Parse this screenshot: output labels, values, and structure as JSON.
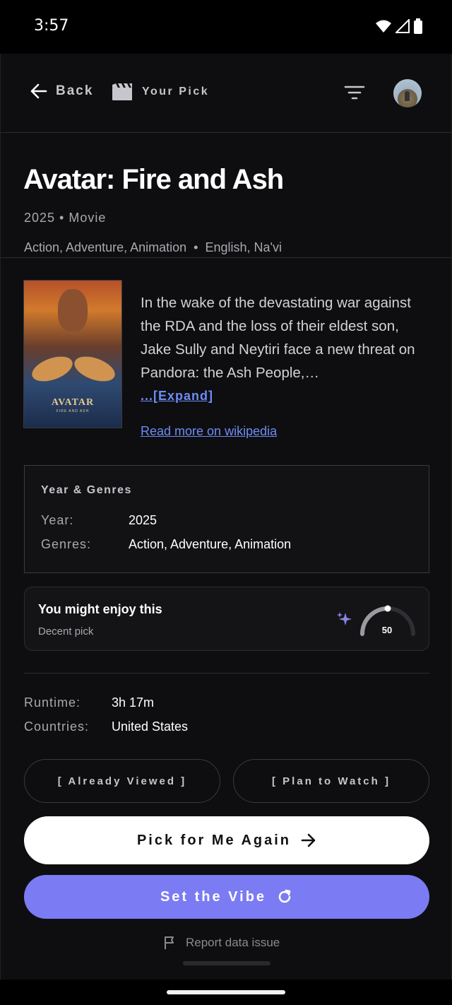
{
  "status_bar": {
    "time": "3:57",
    "icons": [
      "wifi-icon",
      "signal-icon",
      "battery-icon"
    ]
  },
  "nav": {
    "back_label": "Back",
    "brand_label": "Your Pick",
    "icons": [
      "arrow-left-icon",
      "clapperboard-icon",
      "filter-icon"
    ]
  },
  "movie": {
    "title": "Avatar: Fire and Ash",
    "meta": "2025 • Movie",
    "genres_line": "Action, Adventure, Animation",
    "languages": "English, Na'vi",
    "poster_title": "AVATAR",
    "poster_subtitle": "FIRE AND ASH",
    "synopsis": "In the wake of the devastating war against the RDA and the loss of their eldest son, Jake Sully and Neytiri face a new threat on Pandora: the Ash People,…",
    "expand_label": "...[Expand]",
    "wiki_label": "Read more on wikipedia"
  },
  "year_genres": {
    "heading": "Year & Genres",
    "year_key": "Year:",
    "year_value": "2025",
    "genres_key": "Genres:",
    "genres_value": "Action, Adventure, Animation"
  },
  "recommendation": {
    "title": "You might enjoy this",
    "subtitle": "Decent pick",
    "score": "50",
    "score_fraction": 0.5,
    "accent_color": "#7b7bf3"
  },
  "details": {
    "runtime_key": "Runtime:",
    "runtime_value": "3h 17m",
    "countries_key": "Countries:",
    "countries_value": "United States"
  },
  "actions": {
    "already_viewed": "[ Already Viewed ]",
    "plan_to_watch": "[ Plan to Watch ]",
    "pick_again": "Pick for Me Again",
    "set_vibe": "Set the Vibe",
    "report": "Report data issue"
  },
  "colors": {
    "background": "#0e0e10",
    "link": "#6d8cf5",
    "primary_button": "#ffffff",
    "vibe_button": "#7b7bf3"
  }
}
